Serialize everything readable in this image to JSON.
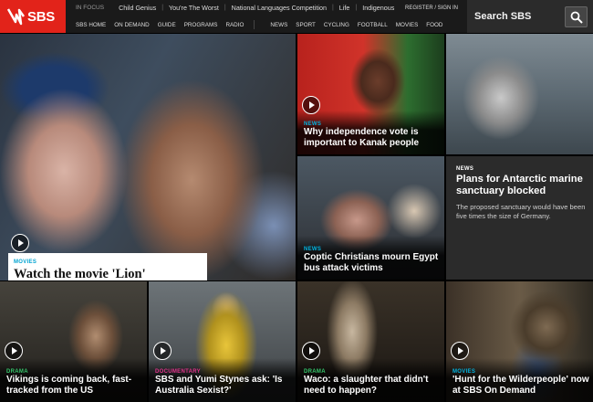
{
  "brand": {
    "name": "SBS",
    "color": "#e2231a"
  },
  "infocus": {
    "label": "IN FOCUS",
    "items": [
      "Child Genius",
      "You're The Worst",
      "National Languages Competition",
      "Life",
      "Indigenous"
    ],
    "account": "REGISTER / SIGN IN"
  },
  "nav": {
    "left": [
      "SBS HOME",
      "ON DEMAND",
      "GUIDE",
      "PROGRAMS",
      "RADIO"
    ],
    "right": [
      "NEWS",
      "SPORT",
      "CYCLING",
      "FOOTBALL",
      "MOVIES",
      "FOOD"
    ]
  },
  "search": {
    "placeholder": "Search SBS",
    "icon": "search-icon"
  },
  "tiles": {
    "hero": {
      "category": "MOVIES",
      "title": "Watch the movie 'Lion'"
    },
    "vote": {
      "category": "NEWS",
      "title": "Why independence vote is important to Kanak people"
    },
    "seal": {},
    "coptic": {
      "category": "NEWS",
      "title": "Coptic Christians mourn Egypt bus attack victims"
    },
    "antarctic": {
      "category": "NEWS",
      "title": "Plans for Antarctic marine sanctuary blocked",
      "description": "The proposed sanctuary would have been five times the size of Germany."
    },
    "vikings": {
      "category": "DRAMA",
      "title": "Vikings is coming back, fast-tracked from the US"
    },
    "sbs": {
      "category": "DOCUMENTARY",
      "title": "SBS and Yumi Stynes ask: 'Is Australia Sexist?'"
    },
    "waco": {
      "category": "DRAMA",
      "title": "Waco: a slaughter that didn't need to happen?"
    },
    "wilder": {
      "category": "MOVIES",
      "title": "'Hunt for the Wilderpeople' now at SBS On Demand"
    }
  },
  "colors": {
    "news": "#00b4e1",
    "drama": "#35c76b",
    "documentary": "#e0318a",
    "header": "#1a1a1a"
  }
}
